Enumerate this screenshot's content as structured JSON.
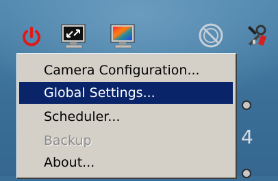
{
  "toolbar": {
    "icons": [
      "power-icon",
      "fullscreen-monitor-icon",
      "color-monitor-icon",
      "disabled-circle-icon",
      "settings-tools-icon"
    ]
  },
  "side": {
    "number_fragment": "4"
  },
  "menu": {
    "items": [
      {
        "label": "Camera Configuration...",
        "state": "normal"
      },
      {
        "label": "Global Settings...",
        "state": "selected"
      },
      {
        "label": "Scheduler...",
        "state": "normal"
      },
      {
        "label": "Backup",
        "state": "disabled"
      },
      {
        "label": "About...",
        "state": "normal"
      }
    ]
  },
  "colors": {
    "desktop": "#3a6e96",
    "menu_bg": "#d4d0c8",
    "selection": "#0a246a",
    "power_red": "#e01818"
  }
}
